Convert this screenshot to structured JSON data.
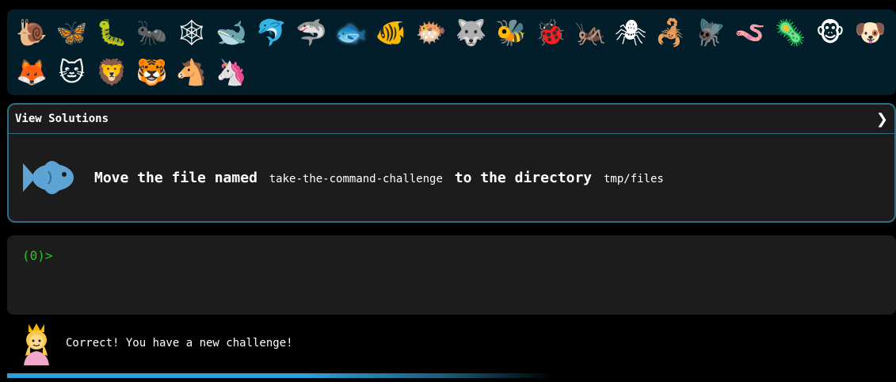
{
  "animals": [
    {
      "name": "snail",
      "glyph": "🐌"
    },
    {
      "name": "butterfly",
      "glyph": "🦋"
    },
    {
      "name": "bug",
      "glyph": "🐛"
    },
    {
      "name": "ant",
      "glyph": "🐜"
    },
    {
      "name": "spider-web",
      "glyph": "🕸"
    },
    {
      "name": "whale",
      "glyph": "🐋"
    },
    {
      "name": "dolphin",
      "glyph": "🐬"
    },
    {
      "name": "shark",
      "glyph": "🦈"
    },
    {
      "name": "fish",
      "glyph": "🐟",
      "active": true
    },
    {
      "name": "tropical-fish",
      "glyph": "🐠"
    },
    {
      "name": "blowfish",
      "glyph": "🐡"
    },
    {
      "name": "wolf",
      "glyph": "🐺"
    },
    {
      "name": "bee",
      "glyph": "🐝"
    },
    {
      "name": "ladybug",
      "glyph": "🐞"
    },
    {
      "name": "cricket",
      "glyph": "🦗"
    },
    {
      "name": "spider",
      "glyph": "🕷"
    },
    {
      "name": "scorpion",
      "glyph": "🦂"
    },
    {
      "name": "fly",
      "glyph": "🪰"
    },
    {
      "name": "worm",
      "glyph": "🪱"
    },
    {
      "name": "microbe",
      "glyph": "🦠"
    },
    {
      "name": "monkey",
      "glyph": "🐵"
    },
    {
      "name": "dog",
      "glyph": "🐶"
    },
    {
      "name": "fox",
      "glyph": "🦊"
    },
    {
      "name": "cat",
      "glyph": "🐱"
    },
    {
      "name": "lion",
      "glyph": "🦁"
    },
    {
      "name": "tiger",
      "glyph": "🐯"
    },
    {
      "name": "horse",
      "glyph": "🐴"
    },
    {
      "name": "unicorn",
      "glyph": "🦄"
    }
  ],
  "panel": {
    "title": "View Solutions",
    "chevron": "❯"
  },
  "task": {
    "prefix": "Move the file named",
    "file": "take-the-command-challenge",
    "middle": "to the directory",
    "dir": "tmp/files"
  },
  "terminal": {
    "prompt": "(0)>"
  },
  "feedback": {
    "message": "Correct! You have a new challenge!"
  },
  "progress": {
    "fraction": 0.61
  },
  "colors": {
    "accent": "#2a6e8a",
    "prompt": "#2fc425",
    "strip_bg": "#021e2a",
    "panel_bg": "#1c1c1c",
    "progress": "#2e9fd6"
  }
}
